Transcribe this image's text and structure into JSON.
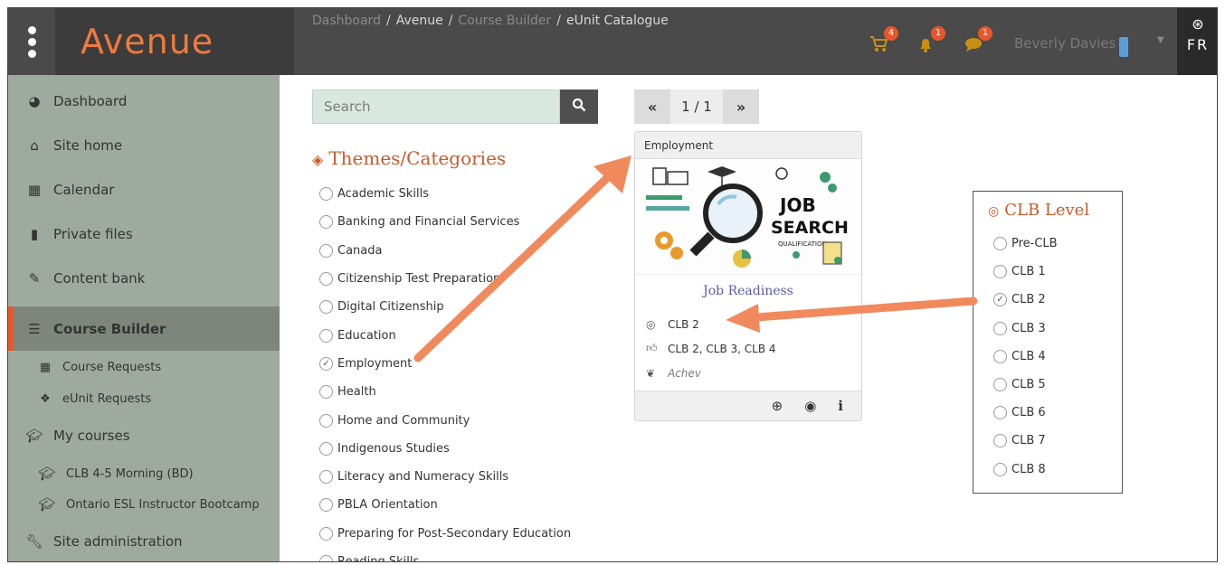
{
  "app": {
    "logo": "Avenue"
  },
  "breadcrumbs": [
    "Dashboard",
    "Avenue",
    "Course Builder",
    "eUnit Catalogue"
  ],
  "header": {
    "badges": {
      "cart": "4",
      "notifications": "1",
      "messages": "1"
    },
    "user_name": "Beverly Davies",
    "language": "FR"
  },
  "sidebar": {
    "items": [
      {
        "label": "Dashboard",
        "icon": "dashboard-icon"
      },
      {
        "label": "Site home",
        "icon": "home-icon"
      },
      {
        "label": "Calendar",
        "icon": "calendar-icon"
      },
      {
        "label": "Private files",
        "icon": "file-icon"
      },
      {
        "label": "Content bank",
        "icon": "brush-icon"
      },
      {
        "label": "Course Builder",
        "icon": "database-icon",
        "active": true
      },
      {
        "label": "Course Requests",
        "icon": "grid-icon"
      },
      {
        "label": "eUnit Requests",
        "icon": "cubes-icon"
      },
      {
        "label": "My courses",
        "icon": "graduation-cap-icon"
      },
      {
        "label": "CLB 4-5 Morning (BD)",
        "icon": "graduation-cap-icon"
      },
      {
        "label": "Ontario ESL Instructor Bootcamp",
        "icon": "graduation-cap-icon"
      },
      {
        "label": "Site administration",
        "icon": "wrench-icon"
      }
    ]
  },
  "search": {
    "placeholder": "Search"
  },
  "categories": {
    "title": "Themes/Categories",
    "items": [
      {
        "label": "Academic Skills",
        "checked": false
      },
      {
        "label": "Banking and Financial Services",
        "checked": false
      },
      {
        "label": "Canada",
        "checked": false
      },
      {
        "label": "Citizenship Test Preparation",
        "checked": false
      },
      {
        "label": "Digital Citizenship",
        "checked": false
      },
      {
        "label": "Education",
        "checked": false
      },
      {
        "label": "Employment",
        "checked": true
      },
      {
        "label": "Health",
        "checked": false
      },
      {
        "label": "Home and Community",
        "checked": false
      },
      {
        "label": "Indigenous Studies",
        "checked": false
      },
      {
        "label": "Literacy and Numeracy Skills",
        "checked": false
      },
      {
        "label": "PBLA Orientation",
        "checked": false
      },
      {
        "label": "Preparing for Post-Secondary Education",
        "checked": false
      },
      {
        "label": "Reading Skills",
        "checked": false
      }
    ]
  },
  "pager": {
    "prev": "«",
    "page": "1 / 1",
    "next": "»"
  },
  "card": {
    "category": "Employment",
    "image_text": {
      "line1": "JOB",
      "line2": "SEARCH",
      "line3": "QUALIFICATION"
    },
    "title": "Job Readiness",
    "clb_level": "CLB 2",
    "recommended_levels": "CLB 2, CLB 3, CLB 4",
    "provider": "Achev"
  },
  "clb_filter": {
    "title": "CLB Level",
    "items": [
      {
        "label": "Pre-CLB",
        "checked": false
      },
      {
        "label": "CLB 1",
        "checked": false
      },
      {
        "label": "CLB 2",
        "checked": true
      },
      {
        "label": "CLB 3",
        "checked": false
      },
      {
        "label": "CLB 4",
        "checked": false
      },
      {
        "label": "CLB 5",
        "checked": false
      },
      {
        "label": "CLB 6",
        "checked": false
      },
      {
        "label": "CLB 7",
        "checked": false
      },
      {
        "label": "CLB 8",
        "checked": false
      }
    ]
  },
  "colors": {
    "accent": "#e8572a",
    "annotation_arrow": "#f08a5d",
    "heading": "#c85a2b",
    "sidebar": "#9faa9e"
  }
}
